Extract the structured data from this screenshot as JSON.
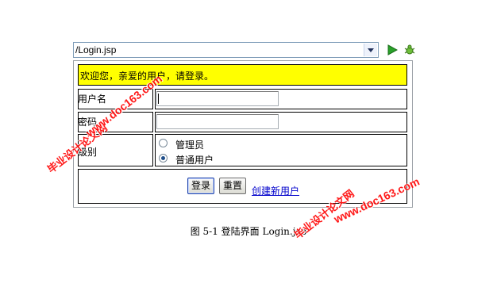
{
  "browser": {
    "address": "/Login.jsp",
    "go_icon": "play-icon",
    "debug_icon": "bug-icon"
  },
  "form": {
    "welcome": "欢迎您，亲爱的用户，请登录。",
    "username_label": "用户名",
    "username_value": "",
    "password_label": "密码",
    "password_value": "",
    "level_label": "级别",
    "options": [
      {
        "label": "管理员",
        "selected": false
      },
      {
        "label": "普通用户",
        "selected": true
      }
    ],
    "login_button": "登录",
    "reset_button": "重置",
    "register_link": "创建新用户"
  },
  "caption": "图 5-1  登陆界面 Login.jsp",
  "watermarks": {
    "site": "www.doc163.com",
    "brand": "毕业设计论文网"
  },
  "colors": {
    "banner": "#ffff00",
    "link": "#0000cc",
    "watermark": "#ff0000"
  }
}
